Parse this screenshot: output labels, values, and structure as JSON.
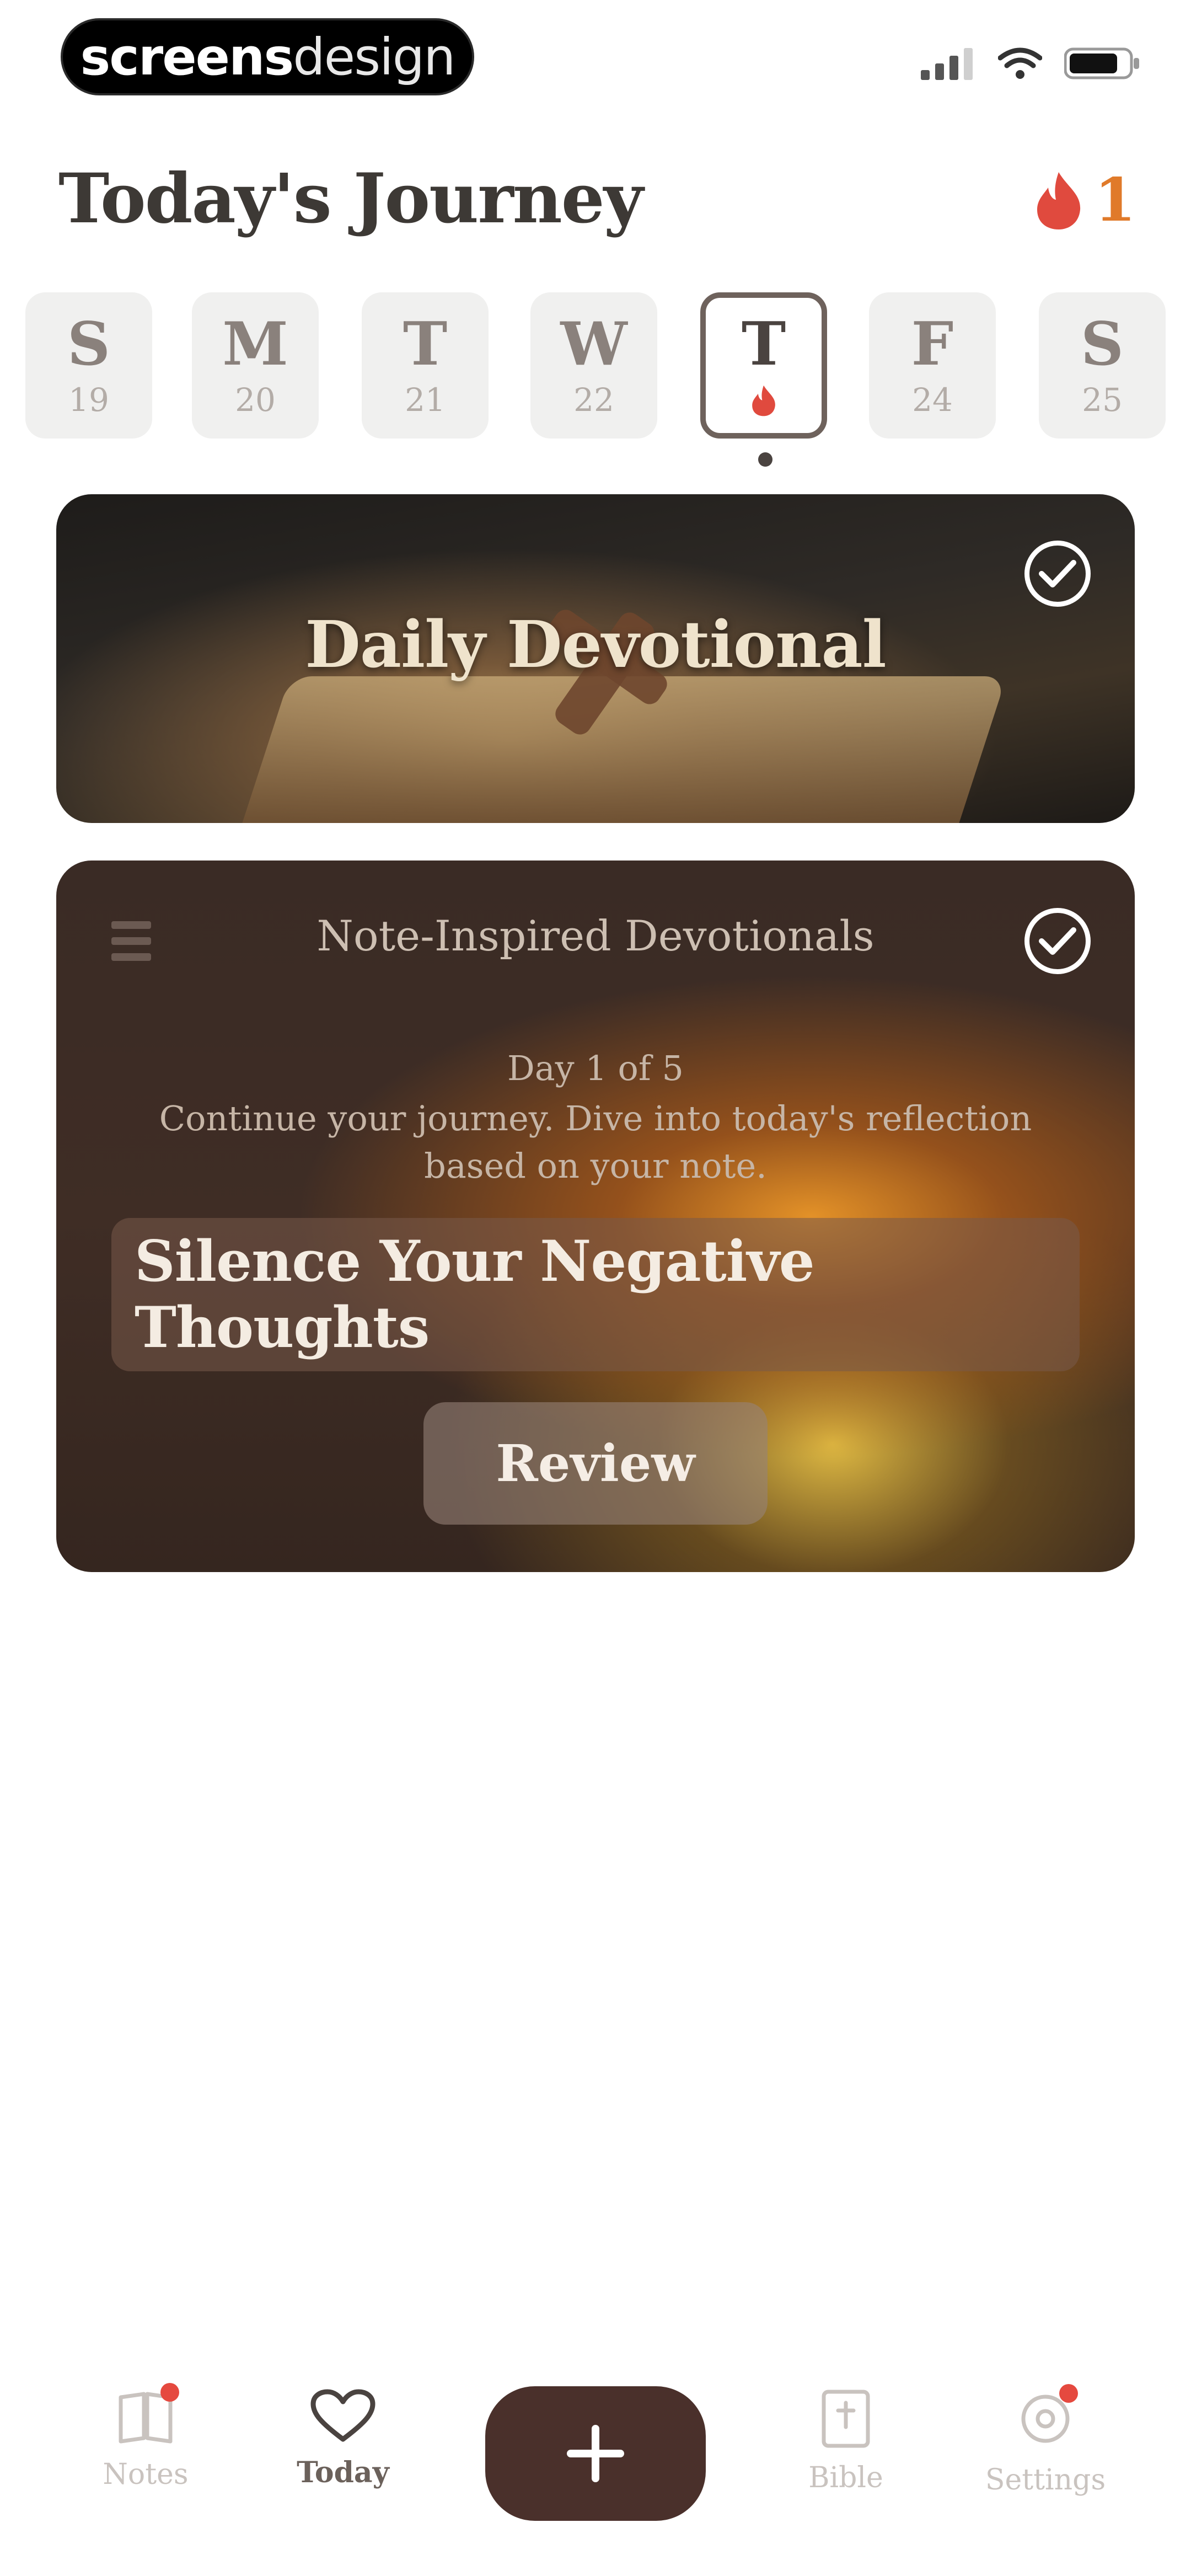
{
  "status_bar": {
    "brand_bold": "screens",
    "brand_light": "design",
    "icons": [
      "signal-icon",
      "wifi-icon",
      "battery-icon"
    ]
  },
  "header": {
    "title": "Today's Journey",
    "streak_count": "1",
    "streak_icon": "flame-icon"
  },
  "week": [
    {
      "letter": "S",
      "date": "19"
    },
    {
      "letter": "M",
      "date": "20"
    },
    {
      "letter": "T",
      "date": "21"
    },
    {
      "letter": "W",
      "date": "22"
    },
    {
      "letter": "T",
      "date": "",
      "active": true
    },
    {
      "letter": "F",
      "date": "24"
    },
    {
      "letter": "S",
      "date": "25"
    }
  ],
  "daily_card": {
    "title": "Daily Devotional",
    "completed": true
  },
  "note_card": {
    "header": "Note-Inspired Devotionals",
    "day": "Day 1 of 5",
    "description": "Continue your journey. Dive into today's reflection based on your note.",
    "topic": "Silence Your Negative Thoughts",
    "button": "Review",
    "completed": true
  },
  "nav": {
    "items": [
      {
        "label": "Notes",
        "icon": "notes-icon",
        "badge": true
      },
      {
        "label": "Today",
        "icon": "heart-icon",
        "active": true
      },
      {
        "label": "Bible",
        "icon": "bible-icon"
      },
      {
        "label": "Settings",
        "icon": "settings-icon",
        "badge": true
      }
    ],
    "add_icon": "plus-icon"
  },
  "colors": {
    "accent": "#4a302b",
    "streak": "#e07a2a",
    "badge": "#e5493f"
  }
}
